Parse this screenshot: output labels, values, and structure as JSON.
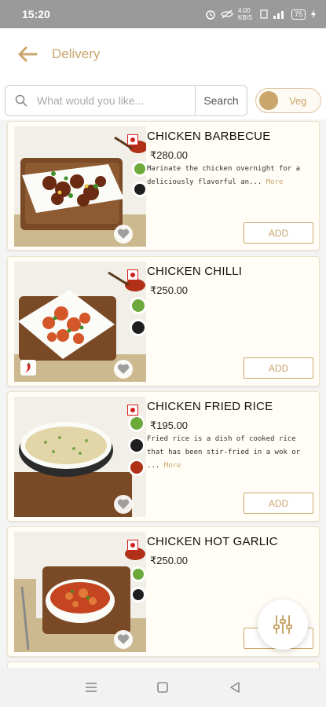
{
  "status_bar": {
    "time": "15:20",
    "network": "4.00 KB/S",
    "battery": "75"
  },
  "header": {
    "title": "Delivery"
  },
  "search": {
    "placeholder": "What would you like...",
    "value": "",
    "button_label": "Search"
  },
  "veg_toggle": {
    "label": "Veg"
  },
  "colors": {
    "accent": "#c9a66b",
    "nonveg": "#d61f1f"
  },
  "products": [
    {
      "name": "CHICKEN BARBECUE",
      "price": "₹280.00",
      "description": "Marinate the chicken overnight for a deliciously flavorful an...",
      "more": "More",
      "add": "ADD",
      "image": "chicken-barbecue-dish"
    },
    {
      "name": "CHICKEN CHILLI",
      "price": "₹250.00",
      "description": "",
      "more": "",
      "add": "ADD",
      "image": "chicken-chilli-dish"
    },
    {
      "name": "CHICKEN FRIED RICE",
      "price": "₹195.00",
      "description": "Fried rice is a dish of cooked rice that has been stir-fried in a wok or ...",
      "more": "More",
      "add": "ADD",
      "image": "chicken-fried-rice-dish"
    },
    {
      "name": "CHICKEN HOT GARLIC",
      "price": "₹250.00",
      "description": "",
      "more": "",
      "add": "ADD",
      "image": "chicken-hot-garlic-dish"
    }
  ],
  "icons": {
    "back": "arrow-left-icon",
    "search": "search-icon",
    "heart": "heart-icon",
    "filter": "filter-sliders-icon",
    "nonveg": "non-veg-mark-icon",
    "spicy": "chili-icon"
  },
  "nav": [
    "menu",
    "home",
    "back"
  ]
}
